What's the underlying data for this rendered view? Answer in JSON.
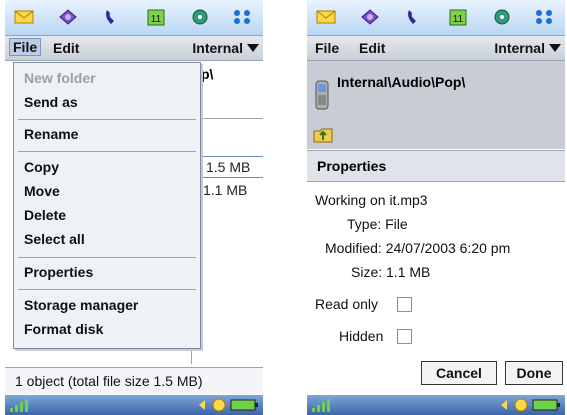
{
  "left": {
    "menubar": {
      "file": "File",
      "edit": "Edit",
      "storage": "Internal"
    },
    "path_fragment": "p\\",
    "menu": {
      "items": [
        "New folder",
        "Send as",
        "Rename",
        "Copy",
        "Move",
        "Delete",
        "Select all",
        "Properties",
        "Storage manager",
        "Format disk"
      ]
    },
    "list": {
      "sizes": [
        "1.5 MB",
        "1.1 MB"
      ]
    },
    "footer": "1 object (total file size 1.5 MB)"
  },
  "right": {
    "menubar": {
      "file": "File",
      "edit": "Edit",
      "storage": "Internal"
    },
    "path": "Internal\\Audio\\Pop\\",
    "dialog": {
      "title": "Properties",
      "working": "Working on it.mp3",
      "type": "Type: File",
      "modified": "Modified: 24/07/2003 6:20 pm",
      "size": "Size: 1.1 MB",
      "read_only": "Read only",
      "hidden": "Hidden",
      "cancel": "Cancel",
      "done": "Done"
    }
  },
  "colors": {
    "accent": "#3a66aa",
    "menubar": "#c9cfd8",
    "dialog_title": "#dfe3ea"
  }
}
